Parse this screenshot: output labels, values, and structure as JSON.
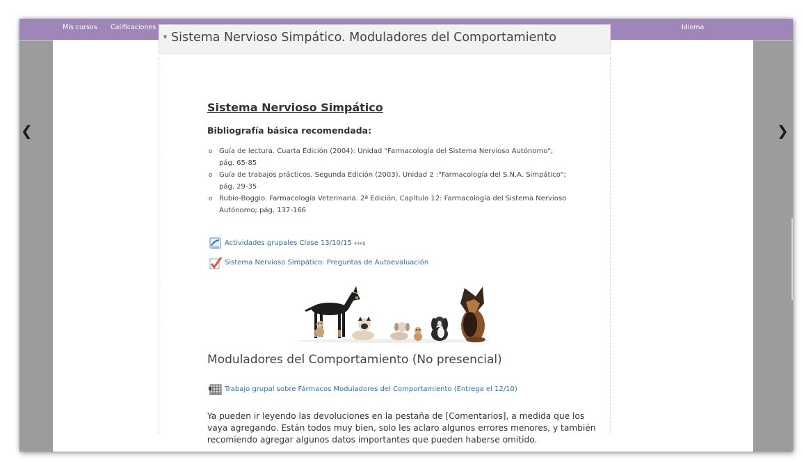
{
  "navbar": {
    "links": [
      "Mis cursos",
      "Calificaciones"
    ],
    "language": "Idioma"
  },
  "colors": {
    "navbar": "#9e86b8",
    "link": "#2a6fb0",
    "side_panel": "#9c9c9c"
  },
  "icons": {
    "prev": "chevron-left-icon",
    "next": "chevron-right-icon",
    "collapse": "caret-down-icon",
    "file": "document-icon",
    "quiz": "quiz-checkmark-icon",
    "assignment": "assignment-icon"
  },
  "section": {
    "title": "Sistema Nervioso Simpático. Moduladores del Comportamiento"
  },
  "content": {
    "heading": "Sistema Nervioso Simpático",
    "biblio_label": "Bibliografía básica recomendada:",
    "references": [
      [
        "Guía de lectura. Cuarta Edición (2004): Unidad \"Farmacología del Sistema Nervioso Autónomo\";",
        "pág. 65-85"
      ],
      [
        "Guía de trabajos prácticos. Segunda Edición (2003), Unidad 2 :\"Farmacología del S.N.A. Simpático\";",
        "pág. 29-35"
      ],
      [
        "Rubio-Boggio. Farmacología Veterinaria. 2ª Edición, Capítulo 12: Farmacología del Sistema Nervioso",
        "Autónomo; pág. 137-166"
      ]
    ],
    "resource_file": {
      "label": "Actividades grupales Clase 13/10/15",
      "size": "44KB"
    },
    "resource_quiz": {
      "label": "Sistema Nervioso Simpático: Preguntas de Autoevaluación"
    },
    "image_alt": "Perros",
    "modulators_heading": "Moduladores del Comportamiento (No presencial)",
    "resource_assignment": {
      "label": "Trabajo grupal sobre Fármacos Moduladores del Comportamiento (Entrega el 12/10)"
    },
    "paragraph_lines": [
      "Ya pueden ir leyendo las devoluciones en la pestaña de [Comentarios], a medida que los",
      "vaya agregando. Están todos muy bien, solo les aclaro algunos errores menores, y también",
      "recomiendo agregar algunos datos importantes que pueden haberse omitido."
    ]
  }
}
